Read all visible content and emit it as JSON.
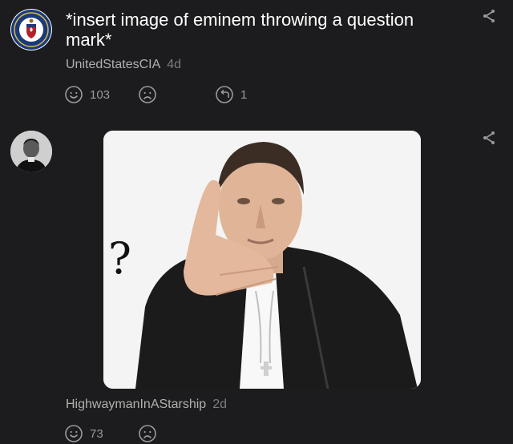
{
  "comments": [
    {
      "text": "*insert image of eminem throwing a question mark*",
      "username": "UnitedStatesCIA",
      "age": "4d",
      "upvotes": "103",
      "replies": "1",
      "avatar_icon": "cia-seal-icon"
    },
    {
      "username": "HighwaymanInAStarship",
      "age": "2d",
      "upvotes": "73",
      "avatar_icon": "user-portrait-icon",
      "image": {
        "question_mark": "?",
        "description_icon": "eminem-pointing-photo"
      }
    }
  ],
  "icons": {
    "share": "share-icon",
    "upvote": "smile-icon",
    "downvote": "frown-icon",
    "reply": "reply-icon"
  },
  "colors": {
    "background": "#1c1c1e",
    "text": "#ffffff",
    "username": "#b0b0b0",
    "muted": "#7c7c7c"
  }
}
